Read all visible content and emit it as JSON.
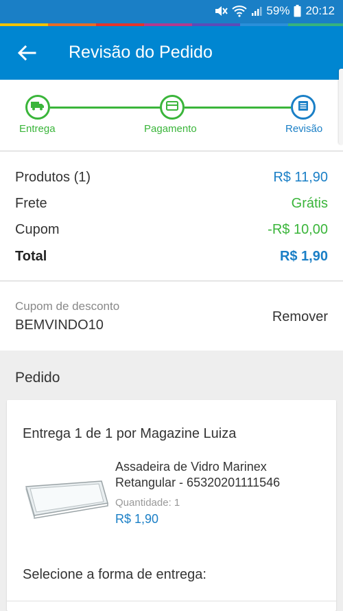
{
  "status_bar": {
    "battery": "59%",
    "time": "20:12"
  },
  "app_bar": {
    "title": "Revisão do Pedido"
  },
  "stepper": {
    "steps": [
      {
        "label": "Entrega",
        "icon": "truck-icon",
        "state": "done"
      },
      {
        "label": "Pagamento",
        "icon": "card-icon",
        "state": "done"
      },
      {
        "label": "Revisão",
        "icon": "list-icon",
        "state": "active"
      }
    ]
  },
  "summary": {
    "produtos_label": "Produtos (1)",
    "produtos_value": "R$ 11,90",
    "frete_label": "Frete",
    "frete_value": "Grátis",
    "cupom_label": "Cupom",
    "cupom_value": "-R$ 10,00",
    "total_label": "Total",
    "total_value": "R$ 1,90"
  },
  "coupon": {
    "label": "Cupom de desconto",
    "code": "BEMVINDO10",
    "remove_label": "Remover"
  },
  "pedido": {
    "title": "Pedido",
    "entrega_title": "Entrega 1 de 1 por Magazine Luiza",
    "product": {
      "name": "Assadeira de Vidro Marinex Retangular - 65320201111546",
      "qty_text": "Quantidade:  1",
      "price": "R$ 1,90"
    },
    "select_delivery_label": "Selecione a forma de entrega:"
  },
  "colors": {
    "primary": "#0086d1",
    "green": "#3ab53a",
    "blue_text": "#1a7fc6"
  }
}
